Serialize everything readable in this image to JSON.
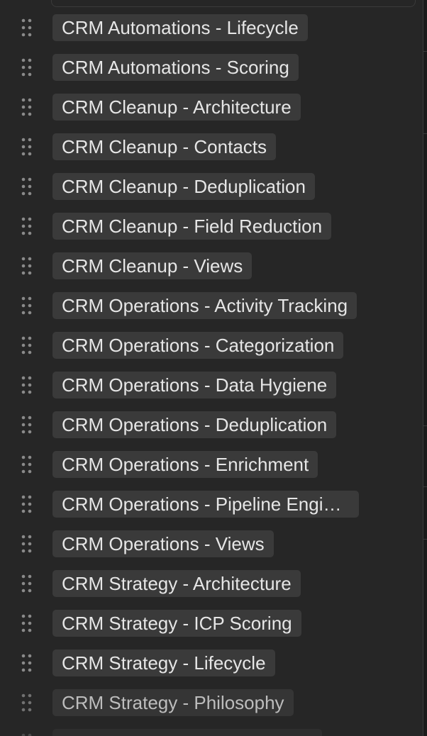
{
  "options": [
    {
      "label": "CRM Automations - Lifecycle"
    },
    {
      "label": "CRM Automations - Scoring"
    },
    {
      "label": "CRM Cleanup - Architecture"
    },
    {
      "label": "CRM Cleanup - Contacts"
    },
    {
      "label": "CRM Cleanup - Deduplication"
    },
    {
      "label": "CRM Cleanup - Field Reduction"
    },
    {
      "label": "CRM Cleanup - Views"
    },
    {
      "label": "CRM Operations - Activity Tracking"
    },
    {
      "label": "CRM Operations - Categorization"
    },
    {
      "label": "CRM Operations - Data Hygiene"
    },
    {
      "label": "CRM Operations - Deduplication"
    },
    {
      "label": "CRM Operations - Enrichment"
    },
    {
      "label": "CRM Operations - Pipeline Engineering"
    },
    {
      "label": "CRM Operations - Views"
    },
    {
      "label": "CRM Strategy - Architecture"
    },
    {
      "label": "CRM Strategy - ICP Scoring"
    },
    {
      "label": "CRM Strategy - Lifecycle"
    },
    {
      "label": "CRM Strategy - Philosophy"
    },
    {
      "label": ""
    }
  ],
  "icons": {
    "drag_handle": "drag-handle-icon"
  },
  "colors": {
    "panel_background": "#262626",
    "pill_background": "#3a3a3a",
    "pill_text": "#e6e6e6",
    "handle": "#8a8a8a"
  }
}
